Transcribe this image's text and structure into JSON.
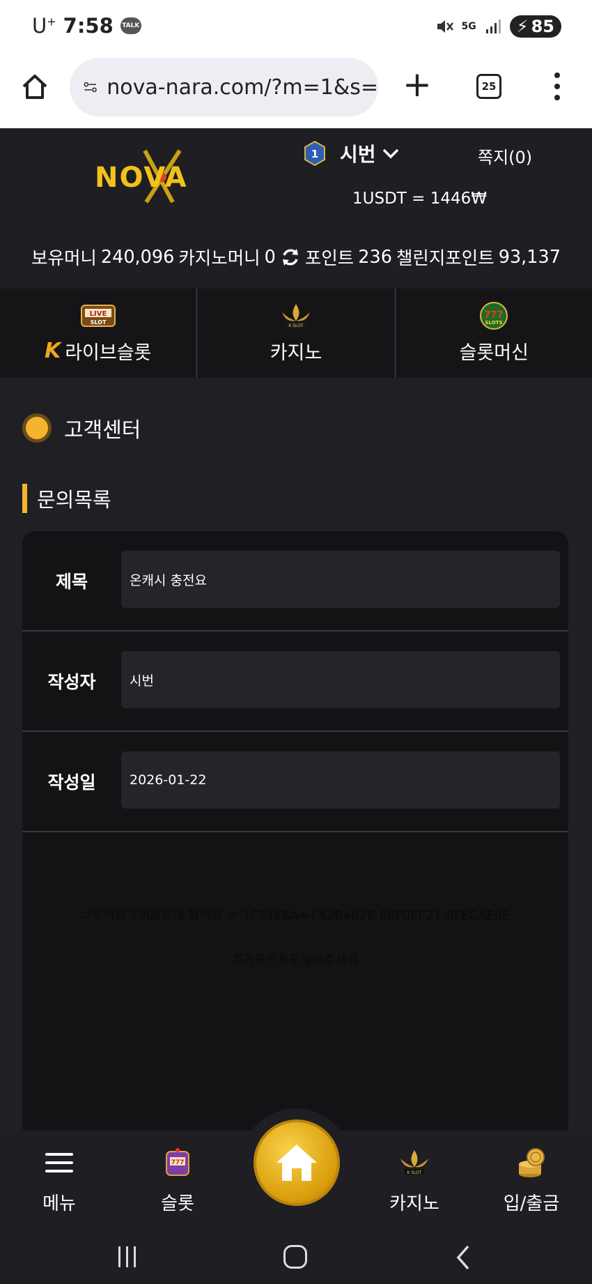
{
  "status_bar": {
    "carrier": "U",
    "carrier_sup": "+",
    "time": "7:58",
    "talk": "TALK",
    "net": "5G",
    "battery": "85"
  },
  "browser": {
    "url": "nova-nara.com/?m=1&s=",
    "tab_count": "25"
  },
  "header": {
    "logo": "NOVA",
    "level": "1",
    "username": "시번",
    "memo": "쪽지(0)",
    "rate": "1USDT = 1446₩",
    "money": {
      "hold_label": "보유머니",
      "hold_value": "240,096",
      "casino_label": "카지노머니",
      "casino_value": "0",
      "point_label": "포인트",
      "point_value": "236",
      "challenge_label": "챌린지포인트",
      "challenge_value": "93,137"
    }
  },
  "categories": [
    {
      "label": "라이브슬롯",
      "icon": "live-slot-icon"
    },
    {
      "label": "카지노",
      "icon": "k-slot-icon"
    },
    {
      "label": "슬롯머신",
      "icon": "777-slots-icon"
    }
  ],
  "content": {
    "section_title": "고객센터",
    "sub_title": "문의목록",
    "fields": [
      {
        "label": "제목",
        "value": "온캐시 충전요"
      },
      {
        "label": "작성자",
        "value": "시번"
      },
      {
        "label": "작성일",
        "value": "2026-01-22"
      }
    ],
    "body_lines": [
      "너무어렵고귀찮은데 했어요 ㅠ 1F336BA4-F42B462E-88F0EF21-9FECAE0E",
      "추가포인트도넣어주세요"
    ]
  },
  "bottom_nav": {
    "menu": "메뉴",
    "slot": "슬롯",
    "casino": "카지노",
    "deposit": "입/출금"
  },
  "colors": {
    "accent": "#f4b42e",
    "background": "#1f1f24",
    "panel": "#131316"
  }
}
